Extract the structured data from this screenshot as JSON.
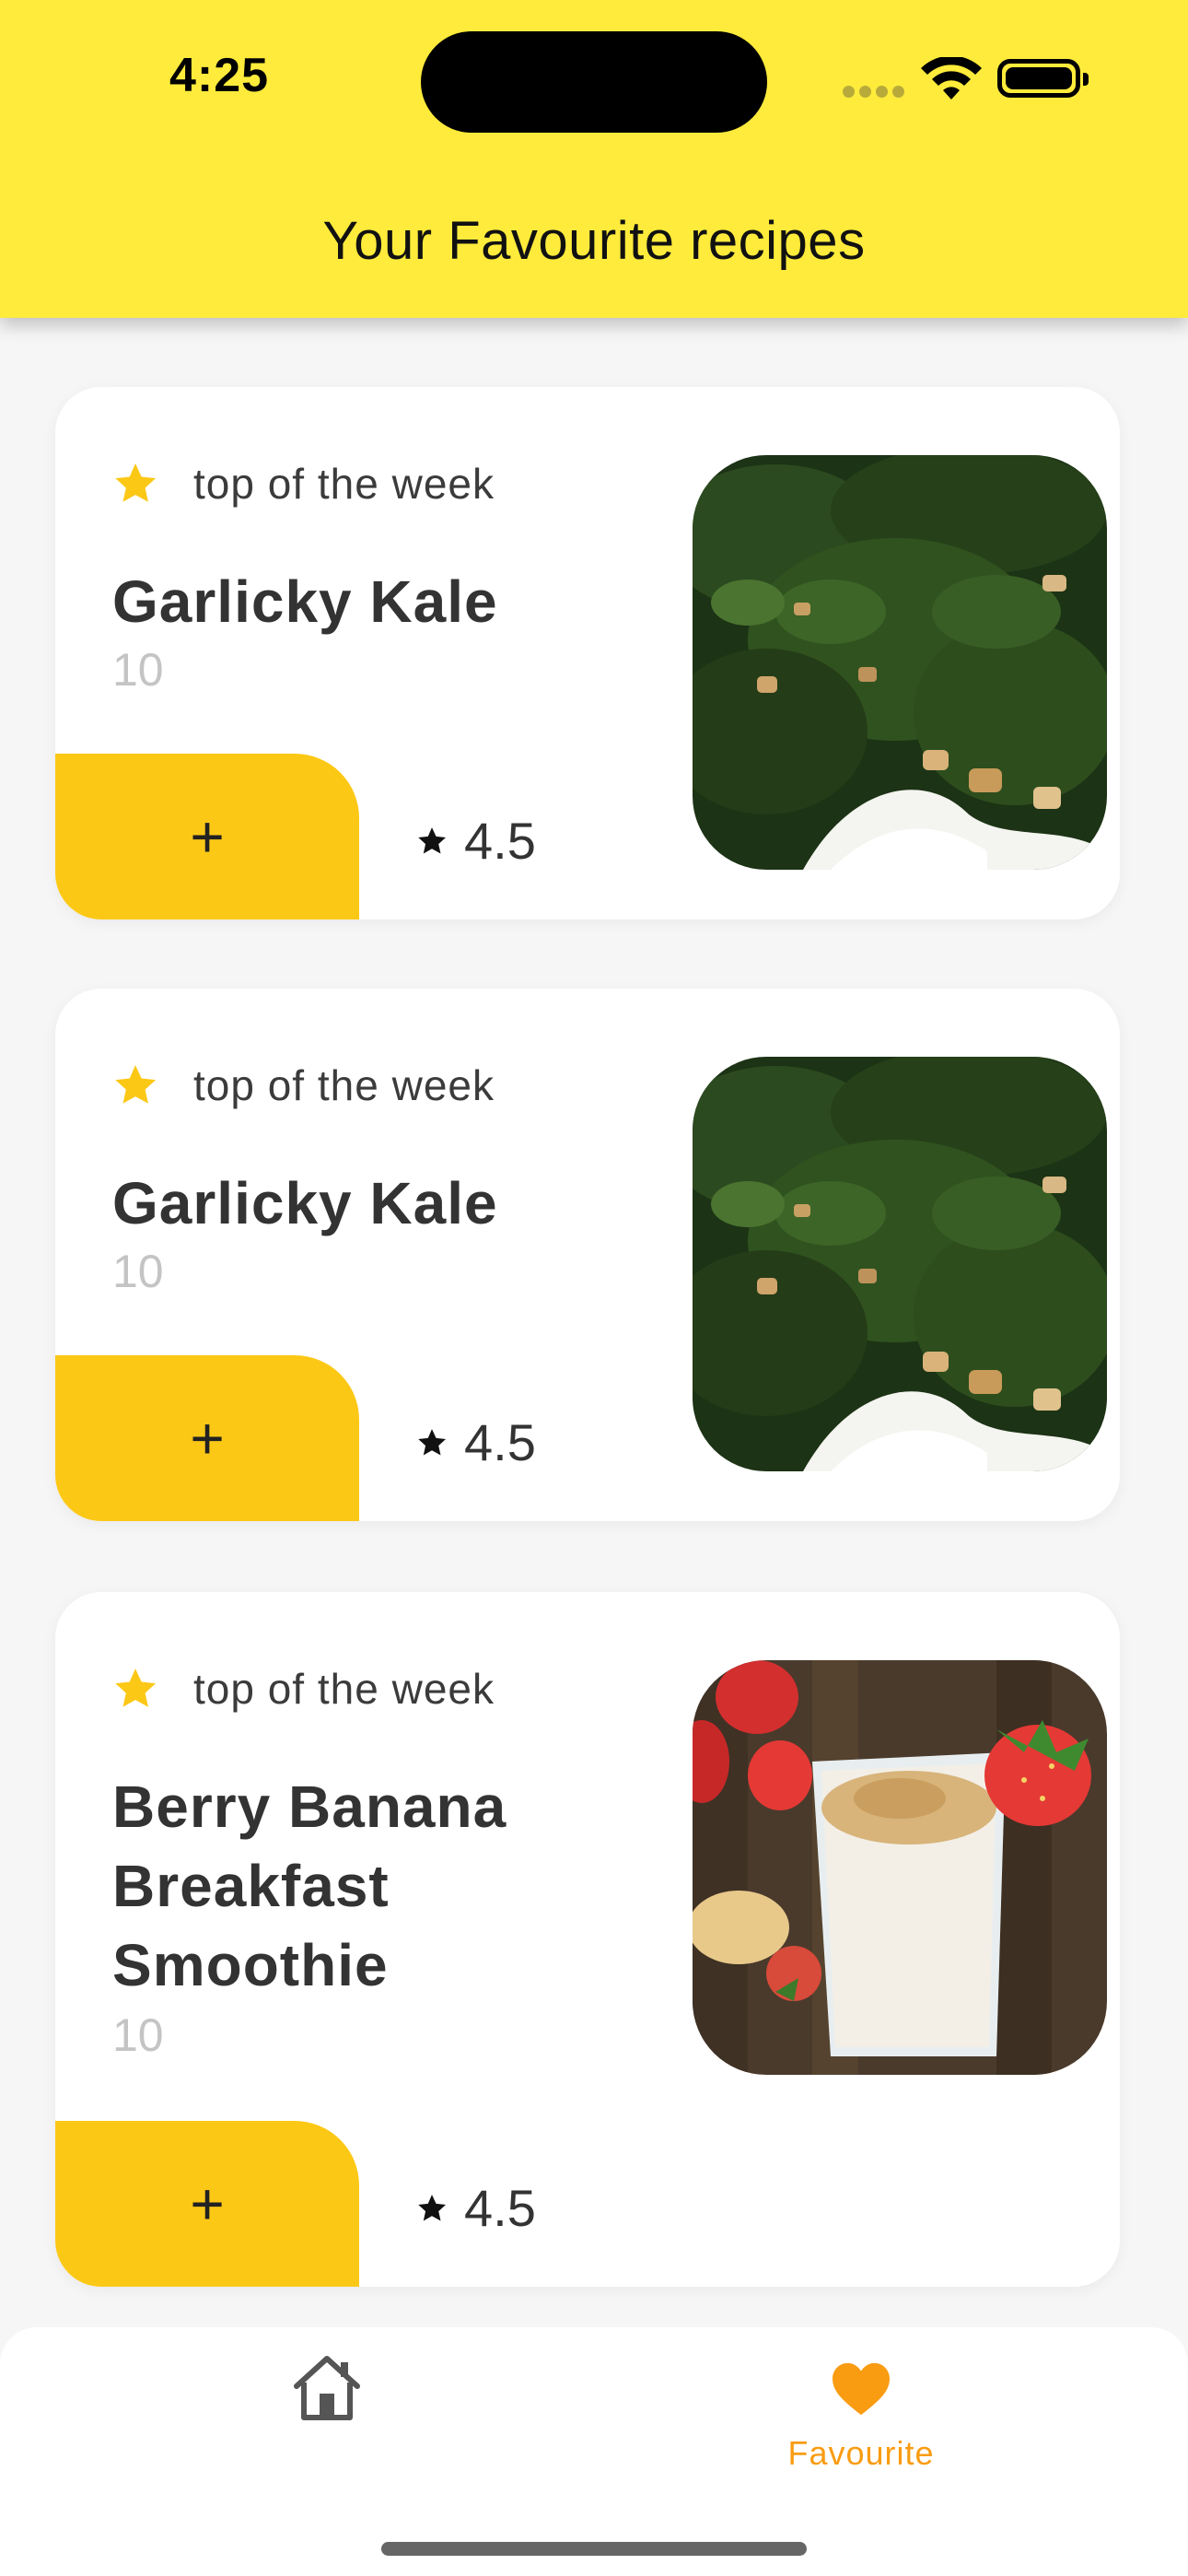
{
  "status_bar": {
    "time": "4:25"
  },
  "header": {
    "title": "Your Favourite recipes",
    "color": "#feeb3b"
  },
  "recipes": [
    {
      "badge": "top of the week",
      "title": "Garlicky Kale",
      "count": "10",
      "add_label": "+",
      "rating": "4.5",
      "image": "kale-photo"
    },
    {
      "badge": "top of the week",
      "title": "Garlicky Kale",
      "count": "10",
      "add_label": "+",
      "rating": "4.5",
      "image": "kale-photo"
    },
    {
      "badge": "top of the week",
      "title": "Berry Banana Breakfast Smoothie",
      "count": "10",
      "add_label": "+",
      "rating": "4.5",
      "image": "smoothie-photo"
    }
  ],
  "bottom_nav": {
    "items": [
      {
        "icon": "home-icon",
        "label": ""
      },
      {
        "icon": "heart-icon",
        "label": "Favourite",
        "active": true
      }
    ],
    "active_color": "#f99c12"
  },
  "colors": {
    "accent": "#fcc816",
    "star": "#fcc816"
  }
}
